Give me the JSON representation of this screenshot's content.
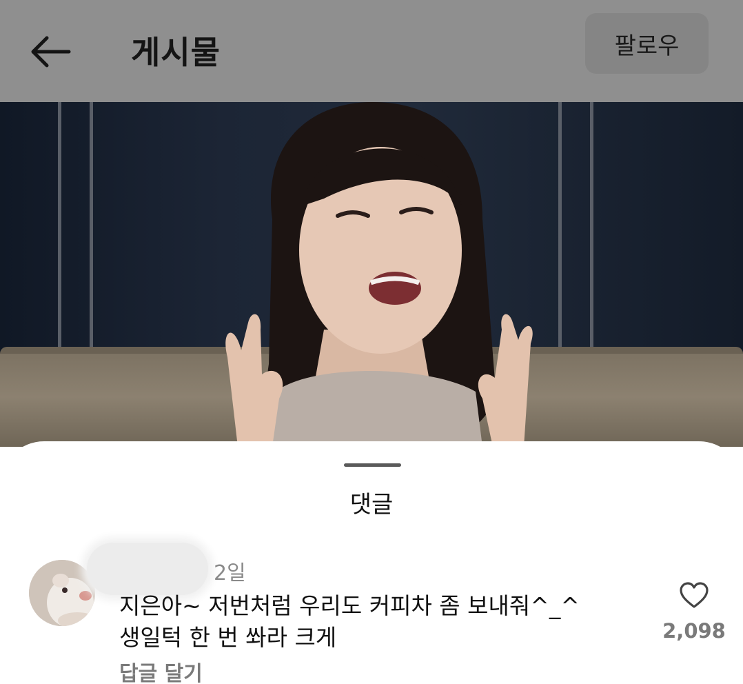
{
  "header": {
    "title": "게시물",
    "follow_label": "팔로우",
    "back_icon": "arrow-left-icon"
  },
  "video": {
    "description_icon": "video-frame"
  },
  "comments_sheet": {
    "title": "댓글",
    "comments": [
      {
        "time": "2일",
        "text_line1": "지은아~ 저번처럼 우리도 커피차 좀 보내줘^_^",
        "text_line2": "생일턱 한 번 쏴라 크게",
        "reply_label": "답글 달기",
        "like_count": "2,098",
        "like_icon": "heart-outline-icon"
      }
    ]
  },
  "colors": {
    "header_dimmed": "#8f8f8f",
    "follow_button_dimmed": "#858585",
    "sheet_background": "#ffffff",
    "secondary_text": "#7a7a7a"
  }
}
